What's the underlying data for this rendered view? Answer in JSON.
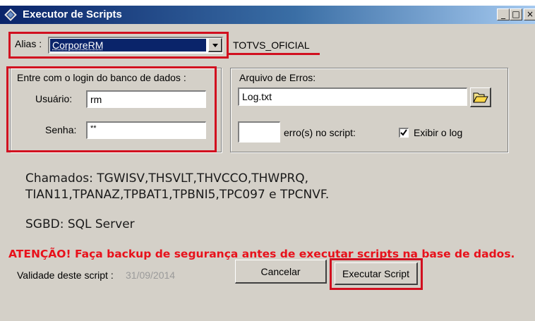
{
  "window": {
    "title": "Executor de Scripts",
    "controls": {
      "minimize": "_",
      "maximize": "□",
      "close": "×"
    }
  },
  "alias": {
    "label": "Alias :",
    "selected": "CorporeRM",
    "database": "TOTVS_OFICIAL"
  },
  "login": {
    "group_title": "Entre com o login do banco de dados :",
    "user_label": "Usuário:",
    "user_value": "rm",
    "password_label": "Senha:",
    "password_value": "**"
  },
  "errors": {
    "group_title": "Arquivo de Erros:",
    "file_value": "Log.txt",
    "count_value": "",
    "count_label": "erro(s) no script:",
    "show_log_label": "Exibir o log",
    "show_log_checked": true
  },
  "info": {
    "chamados_line1": "Chamados: TGWISV,THSVLT,THVCCO,THWPRQ,",
    "chamados_line2": "TIAN11,TPANAZ,TPBAT1,TPBNI5,TPC097 e TPCNVF.",
    "sgbd": "SGBD: SQL Server",
    "warning": "ATENÇÃO! Faça backup de segurança antes de executar scripts na base de dados.",
    "validity_label": "Validade deste script :",
    "validity_date": "31/09/2014"
  },
  "buttons": {
    "cancel": "Cancelar",
    "execute": "Executar Script"
  },
  "colors": {
    "highlight_red": "#d10f1f",
    "warning_red": "#e8111b",
    "selection_blue": "#0a246a"
  }
}
